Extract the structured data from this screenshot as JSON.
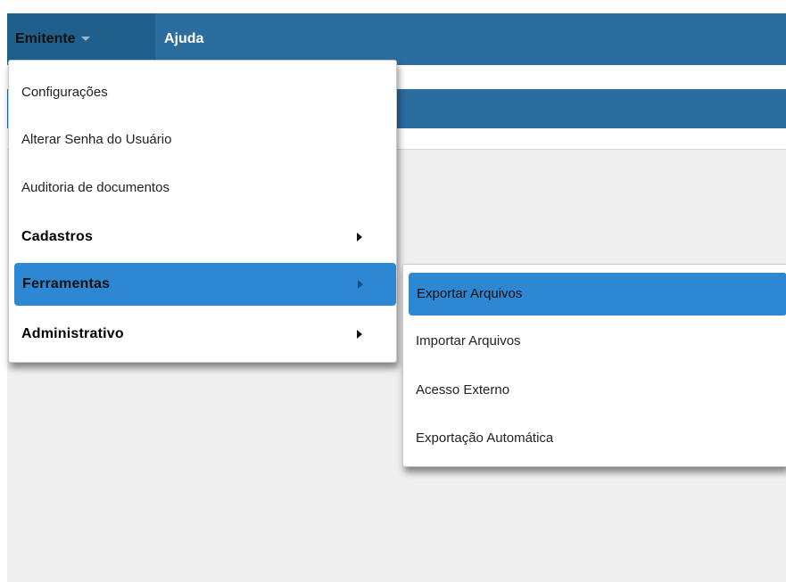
{
  "nav": {
    "items": [
      {
        "label": "Emitente",
        "has_dropdown": true,
        "active": true
      },
      {
        "label": "Ajuda"
      }
    ]
  },
  "emitente_menu": {
    "items": [
      {
        "label": "Configurações"
      },
      {
        "label": "Alterar Senha do Usuário"
      },
      {
        "label": "Auditoria de documentos"
      },
      {
        "label": "Cadastros",
        "submenu": true
      },
      {
        "label": "Ferramentas",
        "submenu": true,
        "highlighted": true
      },
      {
        "label": "Administrativo",
        "submenu": true
      }
    ]
  },
  "ferramentas_submenu": {
    "items": [
      {
        "label": "Exportar Arquivos",
        "highlighted": true
      },
      {
        "label": "Importar Arquivos"
      },
      {
        "label": "Acesso Externo"
      },
      {
        "label": "Exportação Automática"
      }
    ]
  },
  "colors": {
    "nav_bar": "#2c6da0",
    "nav_active": "#1f5f8b",
    "menu_highlight": "#2d87d3",
    "content_background": "#efefef"
  }
}
